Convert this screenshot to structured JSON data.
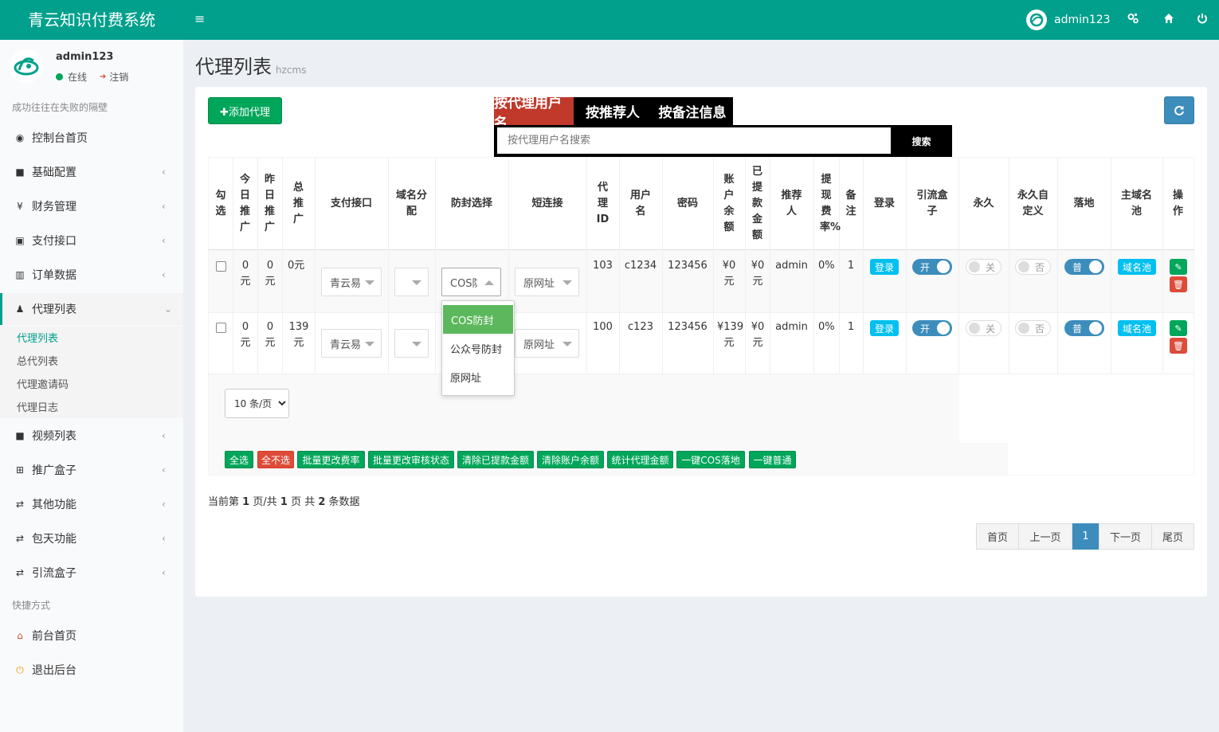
{
  "app": {
    "title": "青云知识付费系统",
    "menu_toggle": "≡",
    "username": "admin123"
  },
  "sidebar": {
    "user": {
      "name": "admin123",
      "status": "在线",
      "logout": "注销"
    },
    "motto": "成功往往在失败的隔壁",
    "items": [
      {
        "label": "控制台首页",
        "icon": "dashboard-icon",
        "glyph": "◉"
      },
      {
        "label": "基础配置",
        "icon": "grid-icon",
        "glyph": "■"
      },
      {
        "label": "财务管理",
        "icon": "yen-icon",
        "glyph": "¥"
      },
      {
        "label": "支付接口",
        "icon": "card-icon",
        "glyph": "▣"
      },
      {
        "label": "订单数据",
        "icon": "bar-chart-icon",
        "glyph": "▥"
      },
      {
        "label": "代理列表",
        "icon": "users-icon",
        "glyph": "♟"
      },
      {
        "label": "视频列表",
        "icon": "video-icon",
        "glyph": "■"
      },
      {
        "label": "推广盒子",
        "icon": "table-icon",
        "glyph": "⊞"
      },
      {
        "label": "其他功能",
        "icon": "retweet-icon",
        "glyph": "⇄"
      },
      {
        "label": "包天功能",
        "icon": "retweet-icon",
        "glyph": "⇄"
      },
      {
        "label": "引流盒子",
        "icon": "retweet-icon",
        "glyph": "⇄"
      }
    ],
    "sub_items": [
      "代理列表",
      "总代列表",
      "代理邀请码",
      "代理日志"
    ],
    "shortcut_header": "快捷方式",
    "shortcuts": [
      {
        "label": "前台首页",
        "icon": "home-icon",
        "glyph": "⌂"
      },
      {
        "label": "退出后台",
        "icon": "power-icon",
        "glyph": "⏻"
      }
    ]
  },
  "page": {
    "title": "代理列表",
    "subtitle": "hzcms"
  },
  "toolbar": {
    "add_label": "✚添加代理",
    "refresh_glyph": "⟳"
  },
  "search": {
    "tabs": [
      "按代理用户名",
      "按推荐人",
      "按备注信息"
    ],
    "placeholder": "按代理用户名搜索",
    "button": "搜索"
  },
  "table": {
    "headers": [
      "勾选",
      "今日推广",
      "昨日推广",
      "总推广",
      "支付接口",
      "域名分配",
      "防封选择",
      "短连接",
      "代理ID",
      "用户名",
      "密码",
      "账户余额",
      "已提款金额",
      "推荐人",
      "提现费率%",
      "备注",
      "登录",
      "引流盒子",
      "永久",
      "永久自定义",
      "落地",
      "主域名池",
      "操作"
    ],
    "rows": [
      {
        "today": "0元",
        "yesterday": "0元",
        "total": "0元",
        "pay": "青云易",
        "domain": "",
        "fengfang": "COS防封",
        "short": "原网址",
        "id": "103",
        "user": "c1234",
        "pwd": "123456",
        "balance": "¥0元",
        "withdrawn": "¥0元",
        "referrer": "admin",
        "rate": "0%",
        "note": "1",
        "login": "登录",
        "yinliu": "开",
        "yongjiu": "关",
        "custom": "否",
        "landing": "普",
        "pool": "域名池"
      },
      {
        "today": "0元",
        "yesterday": "0元",
        "total": "139元",
        "pay": "青云易",
        "domain": "",
        "fengfang": "",
        "short": "原网址",
        "id": "100",
        "user": "c123",
        "pwd": "123456",
        "balance": "¥139元",
        "withdrawn": "¥0元",
        "referrer": "admin",
        "rate": "0%",
        "note": "1",
        "login": "登录",
        "yinliu": "开",
        "yongjiu": "关",
        "custom": "否",
        "landing": "普",
        "pool": "域名池"
      }
    ],
    "dropdown_options": [
      "COS防封",
      "公众号防封",
      "原网址"
    ]
  },
  "page_size": "10 条/页",
  "bulk_actions": [
    "全选",
    "全不选",
    "批量更改费率",
    "批量更改审核状态",
    "清除已提款金额",
    "清除账户余额",
    "统计代理金额",
    "一键COS落地",
    "一键普通"
  ],
  "pagination": {
    "info": {
      "prefix": "当前第",
      "current": "1",
      "mid": "页/共",
      "pages": "1",
      "mid2": "页 共",
      "total": "2",
      "suffix": "条数据"
    },
    "buttons": [
      "首页",
      "上一页",
      "1",
      "下一页",
      "尾页"
    ]
  },
  "colors": {
    "brand": "#00a08c",
    "green": "#00a65a",
    "blue": "#3c8dbc",
    "info": "#00c0ef",
    "danger": "#dd4b39"
  }
}
